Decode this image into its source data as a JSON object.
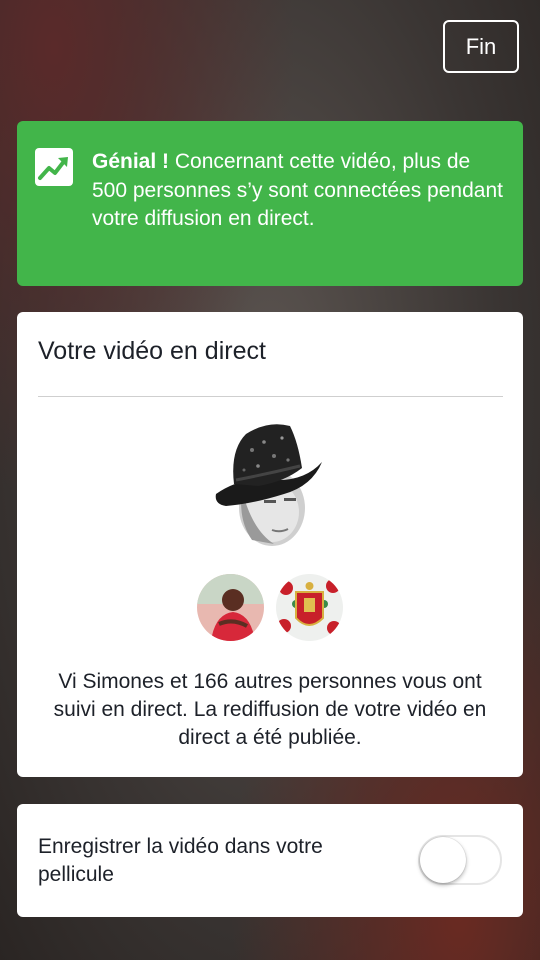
{
  "header": {
    "done_label": "Fin"
  },
  "banner": {
    "icon": "trending-up-icon",
    "bold": "Génial !",
    "message": " Concernant cette vidéo, plus de 500 personnes s’y sont connectées pendant votre diffusion en direct.",
    "color": "#42b54a"
  },
  "live_card": {
    "title": "Votre vidéo en direct",
    "summary": "Vi Simones et 166 autres personnes vous ont suivi en direct. La rediffusion de votre vidéo en direct a été publiée."
  },
  "save_card": {
    "label": "Enregistrer la vidéo dans votre pellicule",
    "toggle_on": false
  }
}
